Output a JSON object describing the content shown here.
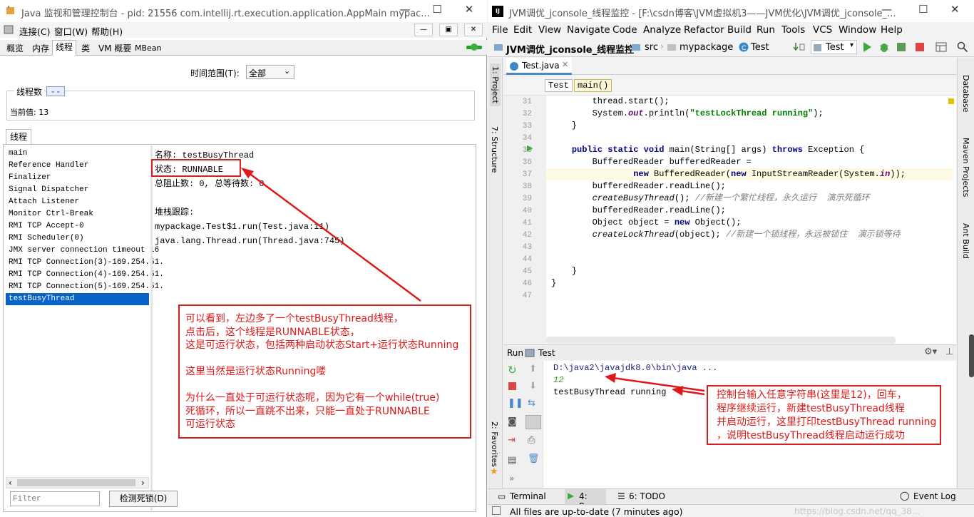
{
  "jconsole": {
    "title": "Java 监视和管理控制台 - pid: 21556 com.intellij.rt.execution.application.AppMain mypac...",
    "menu": [
      "连接(C)",
      "窗口(W)",
      "帮助(H)"
    ],
    "tabs": [
      "概览",
      "内存",
      "线程",
      "类",
      "VM 概要",
      "MBean"
    ],
    "time_range_label": "时间范围(T):",
    "time_range_value": "全部",
    "thread_count_title": "线程数",
    "current_value": "当前值: 13",
    "threads_tab": "线程",
    "threads": [
      "main",
      "Reference Handler",
      "Finalizer",
      "Signal Dispatcher",
      "Attach Listener",
      "Monitor Ctrl-Break",
      "RMI TCP Accept-0",
      "RMI Scheduler(0)",
      "JMX server connection timeout 16",
      "RMI TCP Connection(3)-169.254.51.",
      "RMI TCP Connection(4)-169.254.51.",
      "RMI TCP Connection(5)-169.254.51.",
      "testBusyThread"
    ],
    "detail_name": "名称: testBusyThread",
    "detail_state": "状态: RUNNABLE",
    "detail_blocked": "总阻止数: 0, 总等待数: 0",
    "stack_title": "堆栈跟踪:",
    "stack": [
      "mypackage.Test$1.run(Test.java:11)",
      "java.lang.Thread.run(Thread.java:745)"
    ],
    "filter_placeholder": "Filter",
    "detect_deadlock": "检测死锁(D)",
    "note_lines": [
      "可以看到，左边多了一个testBusyThread线程，",
      "点击后，这个线程是RUNNABLE状态，",
      "这是可运行状态，包括两种启动状态Start+运行状态Running",
      "",
      "这里当然是运行状态Running喽",
      "",
      "为什么一直处于可运行状态呢，因为它有一个while(true)",
      "死循环，所以一直跳不出来，只能一直处于RUNNABLE",
      "可运行状态"
    ]
  },
  "ide": {
    "title": "JVM调优_jconsole_线程监控 - [F:\\csdn博客\\JVM虚拟机3——JVM优化\\JVM调优_jconsole_...",
    "menu": [
      "File",
      "Edit",
      "View",
      "Navigate",
      "Code",
      "Analyze",
      "Refactor",
      "Build",
      "Run",
      "Tools",
      "VCS",
      "Window",
      "Help"
    ],
    "breadcrumb": [
      "JVM调优_jconsole_线程监控",
      "src",
      "mypackage",
      "Test"
    ],
    "run_config": "Test",
    "editor_tab": "Test.java",
    "crumbs": [
      "Test",
      "main()"
    ],
    "line_numbers": [
      "31",
      "32",
      "33",
      "34",
      "35",
      "36",
      "37",
      "38",
      "39",
      "40",
      "41",
      "42",
      "43",
      "44",
      "45",
      "46",
      "47"
    ],
    "left_tools": [
      "1: Project",
      "7: Structure",
      "2: Favorites"
    ],
    "right_tools": [
      "Database",
      "Maven Projects",
      "Ant Build"
    ],
    "run_label": "Run",
    "run_tab": "Test",
    "console": [
      "D:\\java2\\javajdk8.0\\bin\\java ...",
      "12",
      "testBusyThread running"
    ],
    "console_note": [
      "控制台输入任意字符串(这里是12)，回车，",
      "程序继续运行，新建testBusyThread线程",
      "并启动运行，这里打印testBusyThread running",
      "，说明testBusyThread线程启动运行成功"
    ],
    "bottom_tabs": [
      "Terminal",
      "4: Run",
      "6: TODO",
      "Event Log"
    ],
    "status": "All files are up-to-date (7 minutes ago)",
    "watermark": "https://blog.csdn.net/qq_38..."
  },
  "colors": {
    "accent": "#d42020",
    "selection": "#0a64c8"
  }
}
